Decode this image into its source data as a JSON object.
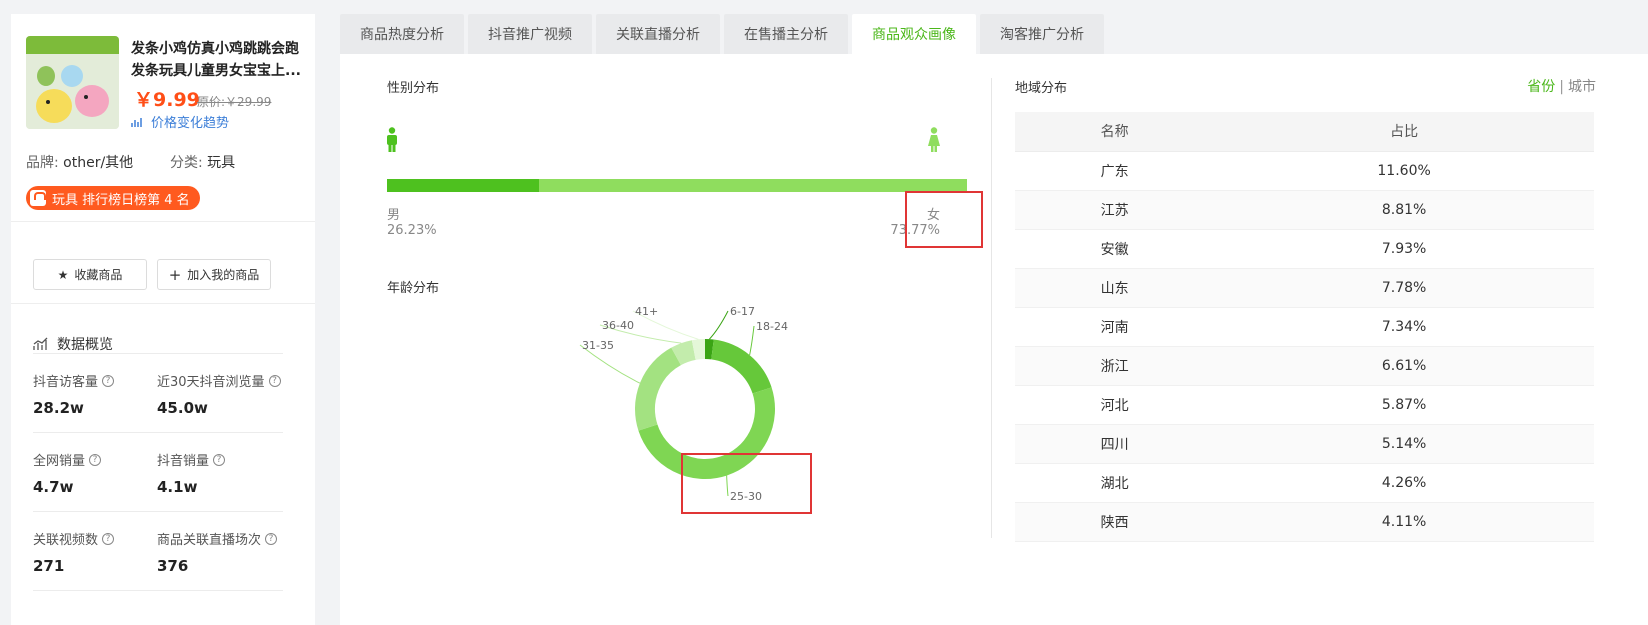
{
  "product": {
    "title_line1": "发条小鸡仿真小鸡跳跳会跑",
    "title_line2": "发条玩具儿童男女宝宝上...",
    "price": "￥9.99",
    "original_price": "原价:￥29.99",
    "trend_link": "价格变化趋势",
    "brand_label": "品牌:",
    "brand_value": "other/其他",
    "category_label": "分类:",
    "category_value": "玩具",
    "rank_badge": "玩具 排行榜日榜第 4 名"
  },
  "actions": {
    "favorite": "收藏商品",
    "add_mine": "加入我的商品"
  },
  "overview": {
    "title": "数据概览",
    "stats": [
      {
        "label": "抖音访客量",
        "value": "28.2w"
      },
      {
        "label": "近30天抖音浏览量",
        "value": "45.0w"
      },
      {
        "label": "全网销量",
        "value": "4.7w"
      },
      {
        "label": "抖音销量",
        "value": "4.1w"
      },
      {
        "label": "关联视频数",
        "value": "271"
      },
      {
        "label": "商品关联直播场次",
        "value": "376"
      }
    ]
  },
  "tabs": [
    {
      "label": "商品热度分析",
      "active": false
    },
    {
      "label": "抖音推广视频",
      "active": false
    },
    {
      "label": "关联直播分析",
      "active": false
    },
    {
      "label": "在售播主分析",
      "active": false
    },
    {
      "label": "商品观众画像",
      "active": true
    },
    {
      "label": "淘客推广分析",
      "active": false
    }
  ],
  "gender": {
    "title": "性别分布",
    "male_label": "男",
    "male_pct": "26.23%",
    "male_value": 26.23,
    "female_label": "女",
    "female_pct": "73.77%",
    "male_color": "#4ec11f",
    "female_color": "#8fdd5e"
  },
  "age": {
    "title": "年龄分布"
  },
  "chart_data": {
    "type": "pie",
    "title": "年龄分布",
    "categories": [
      "6-17",
      "18-24",
      "25-30",
      "31-35",
      "36-40",
      "41+"
    ],
    "values": [
      2,
      18,
      50,
      22,
      5,
      3
    ],
    "colors": [
      "#3aa414",
      "#66c83a",
      "#7fd653",
      "#a3e281",
      "#c3ecac",
      "#e4f7d8"
    ],
    "donut": true
  },
  "region": {
    "title": "地域分布",
    "toggle_province": "省份",
    "toggle_sep": "|",
    "toggle_city": "城市",
    "columns": [
      "名称",
      "占比"
    ],
    "rows": [
      [
        "广东",
        "11.60%"
      ],
      [
        "江苏",
        "8.81%"
      ],
      [
        "安徽",
        "7.93%"
      ],
      [
        "山东",
        "7.78%"
      ],
      [
        "河南",
        "7.34%"
      ],
      [
        "浙江",
        "6.61%"
      ],
      [
        "河北",
        "5.87%"
      ],
      [
        "四川",
        "5.14%"
      ],
      [
        "湖北",
        "4.26%"
      ],
      [
        "陕西",
        "4.11%"
      ]
    ]
  }
}
